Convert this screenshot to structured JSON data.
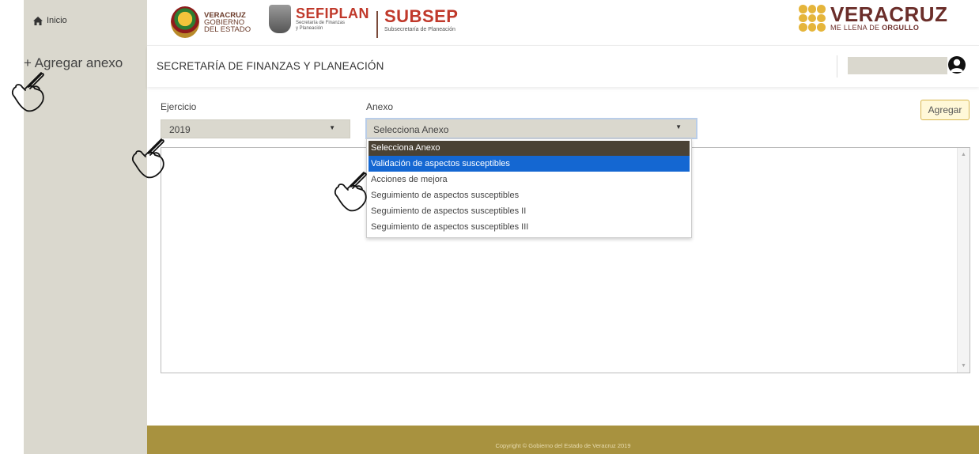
{
  "sidebar": {
    "home_label": "Inicio",
    "add_label": "+ Agregar anexo"
  },
  "header": {
    "gov_logo": {
      "line1": "VERACRUZ",
      "line2": "GOBIERNO",
      "line3": "DEL ESTADO"
    },
    "sefiplan": {
      "name": "SEFIPLAN",
      "sub1": "Secretaría de Finanzas",
      "sub2": "y Planeación"
    },
    "subsep": {
      "name": "SUBSEP",
      "sub": "Subsecretaría de Planeación"
    },
    "orgullo": {
      "line1": "VERACRUZ",
      "line2_prefix": "ME LLENA DE ",
      "line2_bold": "ORGULLO"
    }
  },
  "page": {
    "title": "SECRETARÍA DE FINANZAS Y PLANEACIÓN"
  },
  "form": {
    "ejercicio_label": "Ejercicio",
    "ejercicio_value": "2019",
    "anexo_label": "Anexo",
    "anexo_value": "Selecciona Anexo",
    "agregar_label": "Agregar"
  },
  "dropdown": {
    "options": [
      "Selecciona Anexo",
      "Validación de aspectos susceptibles",
      "Acciones de mejora",
      "Seguimiento de aspectos susceptibles",
      "Seguimiento de aspectos susceptibles II",
      "Seguimiento de aspectos susceptibles III"
    ]
  },
  "footer": {
    "text": "Copyright © Gobierno del Estado de Veracruz 2019"
  },
  "colors": {
    "sidebar_bg": "#dad8ce",
    "footer_bg": "#a8923f",
    "dropdown_selected": "#4a4235",
    "dropdown_hover": "#1467d2",
    "brand_red": "#c0392b",
    "brand_gold": "#e5b53b"
  },
  "icons": [
    "home-icon",
    "user-icon",
    "pointer-hand-icon",
    "caret-down-icon",
    "scroll-up-icon",
    "scroll-down-icon"
  ]
}
